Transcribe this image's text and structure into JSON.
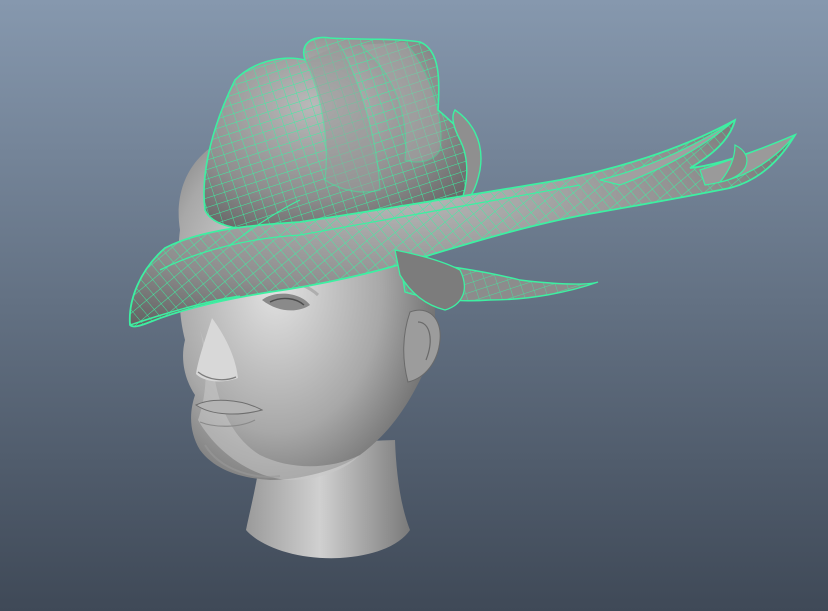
{
  "viewport": {
    "background_top": "#8698ae",
    "background_bottom": "#3f4957",
    "wireframe_color": "#3df0a2",
    "head_light": "#e2e2e2",
    "head_mid": "#a8a8a8",
    "head_dark": "#555555",
    "hat_light": "#b9b9b9",
    "hat_mid": "#8d8d8d",
    "hat_dark": "#5b5b5b"
  },
  "scene": {
    "objects": [
      {
        "name": "head",
        "selected": false
      },
      {
        "name": "hat",
        "selected": true
      }
    ]
  }
}
